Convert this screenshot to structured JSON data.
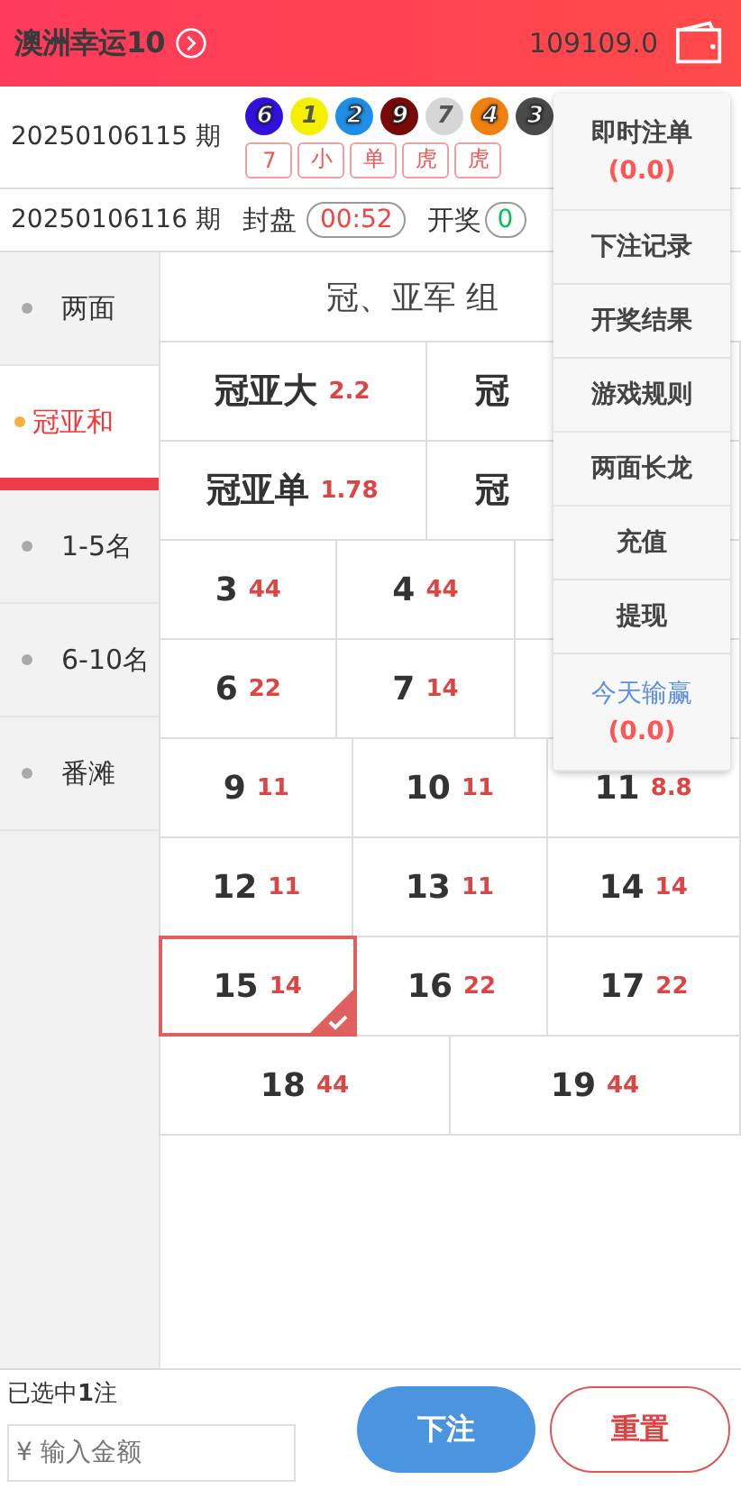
{
  "header": {
    "title": "澳洲幸运10",
    "balance": "109109.0"
  },
  "last_draw": {
    "period": "20250106115 期",
    "balls": [
      {
        "number": "6",
        "color": "#3311dd"
      },
      {
        "number": "1",
        "color": "#f5f000"
      },
      {
        "number": "2",
        "color": "#1e8ee6"
      },
      {
        "number": "9",
        "color": "#7a0a0a"
      },
      {
        "number": "7",
        "color": "#d6d6d6"
      },
      {
        "number": "4",
        "color": "#f08010"
      },
      {
        "number": "3",
        "color": "#4a4a4a"
      }
    ],
    "tags": [
      "7",
      "小",
      "单",
      "虎",
      "虎"
    ]
  },
  "next_draw": {
    "period": "20250106116 期",
    "close_label": "封盘",
    "close_time": "00:52",
    "draw_label": "开奖",
    "draw_time": "0"
  },
  "sidebar": {
    "items": [
      {
        "label": "两面",
        "selected": false
      },
      {
        "label": "冠亚和",
        "selected": true
      },
      {
        "label": "1-5名",
        "selected": false
      },
      {
        "label": "6-10名",
        "selected": false
      },
      {
        "label": "番滩",
        "selected": false
      }
    ]
  },
  "section_title": "冠、亚军 组",
  "bet_rows": [
    {
      "kind": "pair",
      "cells": [
        {
          "label": "冠亚大",
          "odds": "2.2",
          "selected": false
        },
        {
          "label": "冠",
          "selected": false
        }
      ]
    },
    {
      "kind": "pair",
      "cells": [
        {
          "label": "冠亚单",
          "odds": "1.78",
          "selected": false
        },
        {
          "label": "冠",
          "selected": false
        }
      ]
    },
    {
      "kind": "triple",
      "cells": [
        {
          "label": "3",
          "odds": "44",
          "selected": false
        },
        {
          "label": "4",
          "odds": "44",
          "selected": false
        },
        {
          "selected": false
        }
      ]
    },
    {
      "kind": "triple",
      "cells": [
        {
          "label": "6",
          "odds": "22",
          "selected": false
        },
        {
          "label": "7",
          "odds": "14",
          "selected": false
        },
        {
          "selected": false
        }
      ]
    },
    {
      "kind": "triple",
      "cells": [
        {
          "label": "9",
          "odds": "11",
          "selected": false
        },
        {
          "label": "10",
          "odds": "11",
          "selected": false
        },
        {
          "label": "11",
          "odds": "8.8",
          "selected": false
        }
      ]
    },
    {
      "kind": "triple",
      "cells": [
        {
          "label": "12",
          "odds": "11",
          "selected": false
        },
        {
          "label": "13",
          "odds": "11",
          "selected": false
        },
        {
          "label": "14",
          "odds": "14",
          "selected": false
        }
      ]
    },
    {
      "kind": "triple",
      "cells": [
        {
          "label": "15",
          "odds": "14",
          "selected": true
        },
        {
          "label": "16",
          "odds": "22",
          "selected": false
        },
        {
          "label": "17",
          "odds": "22",
          "selected": false
        }
      ]
    },
    {
      "kind": "pair",
      "cells": [
        {
          "label": "18",
          "odds": "44",
          "selected": false
        },
        {
          "label": "19",
          "odds": "44",
          "selected": false
        }
      ]
    }
  ],
  "menu": {
    "items": [
      {
        "kind": "stat",
        "label": "即时注单",
        "amount": "(0.0)"
      },
      {
        "kind": "link",
        "label": "下注记录"
      },
      {
        "kind": "link",
        "label": "开奖结果"
      },
      {
        "kind": "link",
        "label": "游戏规则"
      },
      {
        "kind": "link",
        "label": "两面长龙"
      },
      {
        "kind": "link",
        "label": "充值"
      },
      {
        "kind": "link",
        "label": "提现"
      },
      {
        "kind": "highlight",
        "label": "今天输赢",
        "amount": "(0.0)"
      }
    ]
  },
  "footer": {
    "selected_text": "已选中**1**注",
    "amount_placeholder": "¥ 输入金额",
    "submit": "下注",
    "reset": "重置"
  }
}
